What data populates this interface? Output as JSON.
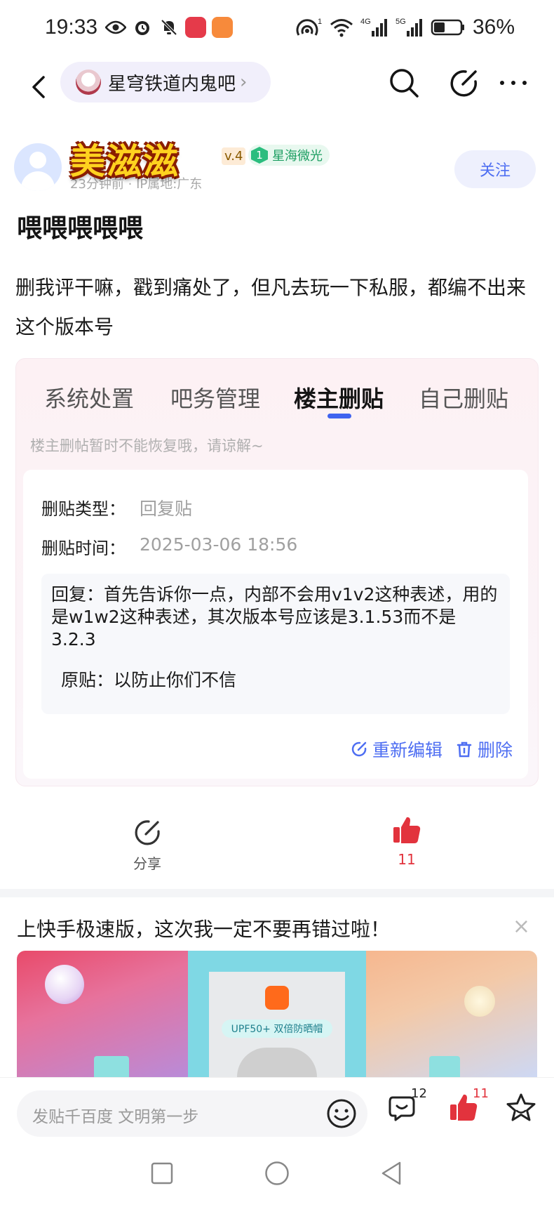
{
  "status_bar": {
    "time": "19:33",
    "battery_percent": "36%",
    "signal_badge": "1",
    "net_4g": "4G",
    "net_5g": "5G"
  },
  "nav": {
    "forum_name": "星穹铁道内鬼吧",
    "back_icon": "chevron-left-icon",
    "search_icon": "search-icon",
    "edit_icon": "compose-icon",
    "more_icon": "more-icon"
  },
  "author": {
    "nickname": "美滋滋",
    "level": "v.4",
    "badge_level": "1",
    "badge_name": "星海微光",
    "meta": "23分钟前 · IP属地:广东",
    "follow_label": "关注"
  },
  "post": {
    "title": "喂喂喂喂喂",
    "content": "删我评干嘛，戳到痛处了，但凡去玩一下私服，都编不出来这个版本号"
  },
  "deleted_card": {
    "tabs": [
      "系统处置",
      "吧务管理",
      "楼主删贴",
      "自己删贴"
    ],
    "active_tab": 2,
    "hint": "楼主删帖暂时不能恢复哦，请谅解~",
    "type_label": "删贴类型：",
    "type_value": "回复贴",
    "time_label": "删贴时间：",
    "time_value": "2025-03-06 18:56",
    "reply_text": "回复：首先告诉你一点，内部不会用v1v2这种表述，用的是w1w2这种表述，其次版本号应该是3.1.53而不是3.2.3",
    "original_text": "原贴：以防止你们不信",
    "reedit_label": "重新编辑",
    "delete_label": "删除"
  },
  "engagement": {
    "share_label": "分享",
    "like_count": "11"
  },
  "ad": {
    "title": "上快手极速版，这次我一定不要再错过啦！",
    "close": "×",
    "product_tag": "UPF50+ 双倍防晒帽"
  },
  "bottom_bar": {
    "input_placeholder": "发贴千百度 文明第一步",
    "comment_count": "12",
    "like_count": "11"
  },
  "colors": {
    "accent": "#4e6ef2",
    "like_red": "#e2333d",
    "badge_green": "#2bbd7e"
  }
}
